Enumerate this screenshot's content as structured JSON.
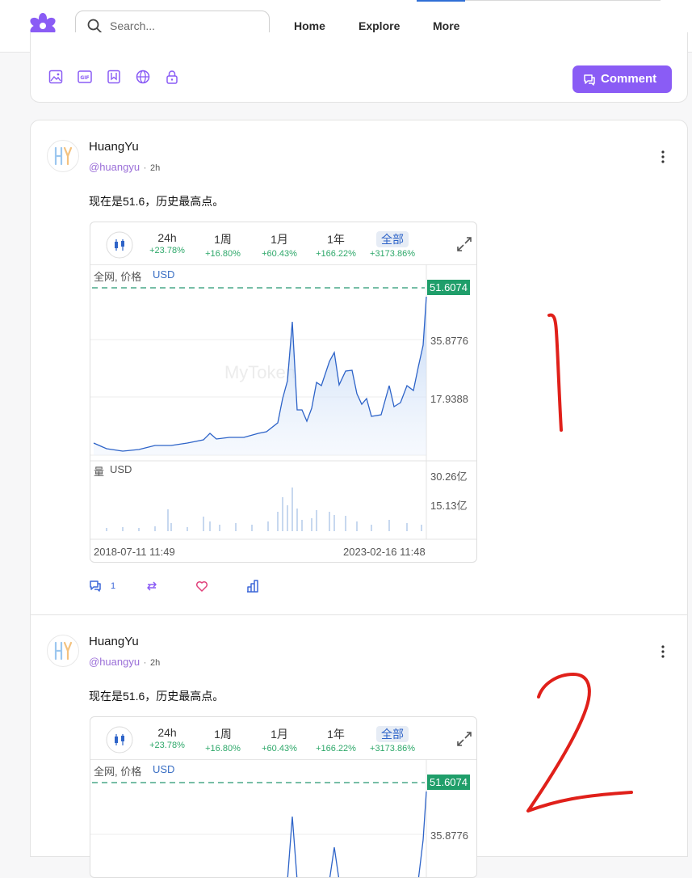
{
  "search": {
    "placeholder": "Search..."
  },
  "nav": {
    "home": "Home",
    "explore": "Explore",
    "more": "More"
  },
  "composer": {
    "comment_label": "Comment",
    "tools": [
      "image-icon",
      "gif-icon",
      "bookmark-icon",
      "globe-icon",
      "lock-icon"
    ]
  },
  "posts": [
    {
      "author": "HuangYu",
      "handle": "@huangyu",
      "separator": "·",
      "time": "2h",
      "text": "现在是51.6，历史最高点。",
      "comments_count": "1",
      "chart": {
        "periods": [
          {
            "name": "24h",
            "change": "+23.78%"
          },
          {
            "name": "1周",
            "change": "+16.80%"
          },
          {
            "name": "1月",
            "change": "+60.43%"
          },
          {
            "name": "1年",
            "change": "+166.22%"
          },
          {
            "name": "全部",
            "change": "+3173.86%"
          }
        ],
        "price_label": "全网, 价格",
        "currency": "USD",
        "watermark": "MyToken",
        "current_price": "51.6074",
        "y_ticks": [
          "35.8776",
          "17.9388"
        ],
        "volume_label": "量",
        "volume_currency": "USD",
        "volume_ticks": [
          "30.26亿",
          "15.13亿"
        ],
        "start_date": "2018-07-11 11:49",
        "end_date": "2023-02-16 11:48"
      }
    },
    {
      "author": "HuangYu",
      "handle": "@huangyu",
      "separator": "·",
      "time": "2h",
      "text": "现在是51.6，历史最高点。",
      "chart": {
        "periods": [
          {
            "name": "24h",
            "change": "+23.78%"
          },
          {
            "name": "1周",
            "change": "+16.80%"
          },
          {
            "name": "1月",
            "change": "+60.43%"
          },
          {
            "name": "1年",
            "change": "+166.22%"
          },
          {
            "name": "全部",
            "change": "+3173.86%"
          }
        ],
        "price_label": "全网, 价格",
        "currency": "USD",
        "current_price": "51.6074",
        "y_ticks": [
          "35.8776"
        ]
      }
    }
  ],
  "colors": {
    "accent": "#8a5cf5",
    "price_up": "#1f9e6a",
    "line": "#2d63c8",
    "scribble": "#e0201a"
  }
}
